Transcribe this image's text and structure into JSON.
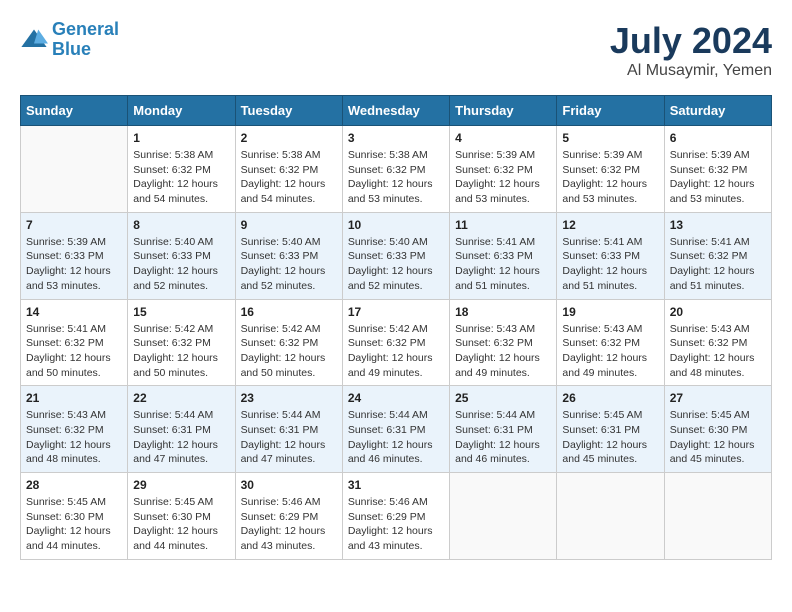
{
  "logo": {
    "line1": "General",
    "line2": "Blue"
  },
  "title": "July 2024",
  "subtitle": "Al Musaymir, Yemen",
  "days_header": [
    "Sunday",
    "Monday",
    "Tuesday",
    "Wednesday",
    "Thursday",
    "Friday",
    "Saturday"
  ],
  "weeks": [
    [
      {
        "day": "",
        "sunrise": "",
        "sunset": "",
        "daylight": ""
      },
      {
        "day": "1",
        "sunrise": "Sunrise: 5:38 AM",
        "sunset": "Sunset: 6:32 PM",
        "daylight": "Daylight: 12 hours and 54 minutes."
      },
      {
        "day": "2",
        "sunrise": "Sunrise: 5:38 AM",
        "sunset": "Sunset: 6:32 PM",
        "daylight": "Daylight: 12 hours and 54 minutes."
      },
      {
        "day": "3",
        "sunrise": "Sunrise: 5:38 AM",
        "sunset": "Sunset: 6:32 PM",
        "daylight": "Daylight: 12 hours and 53 minutes."
      },
      {
        "day": "4",
        "sunrise": "Sunrise: 5:39 AM",
        "sunset": "Sunset: 6:32 PM",
        "daylight": "Daylight: 12 hours and 53 minutes."
      },
      {
        "day": "5",
        "sunrise": "Sunrise: 5:39 AM",
        "sunset": "Sunset: 6:32 PM",
        "daylight": "Daylight: 12 hours and 53 minutes."
      },
      {
        "day": "6",
        "sunrise": "Sunrise: 5:39 AM",
        "sunset": "Sunset: 6:32 PM",
        "daylight": "Daylight: 12 hours and 53 minutes."
      }
    ],
    [
      {
        "day": "7",
        "sunrise": "Sunrise: 5:39 AM",
        "sunset": "Sunset: 6:33 PM",
        "daylight": "Daylight: 12 hours and 53 minutes."
      },
      {
        "day": "8",
        "sunrise": "Sunrise: 5:40 AM",
        "sunset": "Sunset: 6:33 PM",
        "daylight": "Daylight: 12 hours and 52 minutes."
      },
      {
        "day": "9",
        "sunrise": "Sunrise: 5:40 AM",
        "sunset": "Sunset: 6:33 PM",
        "daylight": "Daylight: 12 hours and 52 minutes."
      },
      {
        "day": "10",
        "sunrise": "Sunrise: 5:40 AM",
        "sunset": "Sunset: 6:33 PM",
        "daylight": "Daylight: 12 hours and 52 minutes."
      },
      {
        "day": "11",
        "sunrise": "Sunrise: 5:41 AM",
        "sunset": "Sunset: 6:33 PM",
        "daylight": "Daylight: 12 hours and 51 minutes."
      },
      {
        "day": "12",
        "sunrise": "Sunrise: 5:41 AM",
        "sunset": "Sunset: 6:33 PM",
        "daylight": "Daylight: 12 hours and 51 minutes."
      },
      {
        "day": "13",
        "sunrise": "Sunrise: 5:41 AM",
        "sunset": "Sunset: 6:32 PM",
        "daylight": "Daylight: 12 hours and 51 minutes."
      }
    ],
    [
      {
        "day": "14",
        "sunrise": "Sunrise: 5:41 AM",
        "sunset": "Sunset: 6:32 PM",
        "daylight": "Daylight: 12 hours and 50 minutes."
      },
      {
        "day": "15",
        "sunrise": "Sunrise: 5:42 AM",
        "sunset": "Sunset: 6:32 PM",
        "daylight": "Daylight: 12 hours and 50 minutes."
      },
      {
        "day": "16",
        "sunrise": "Sunrise: 5:42 AM",
        "sunset": "Sunset: 6:32 PM",
        "daylight": "Daylight: 12 hours and 50 minutes."
      },
      {
        "day": "17",
        "sunrise": "Sunrise: 5:42 AM",
        "sunset": "Sunset: 6:32 PM",
        "daylight": "Daylight: 12 hours and 49 minutes."
      },
      {
        "day": "18",
        "sunrise": "Sunrise: 5:43 AM",
        "sunset": "Sunset: 6:32 PM",
        "daylight": "Daylight: 12 hours and 49 minutes."
      },
      {
        "day": "19",
        "sunrise": "Sunrise: 5:43 AM",
        "sunset": "Sunset: 6:32 PM",
        "daylight": "Daylight: 12 hours and 49 minutes."
      },
      {
        "day": "20",
        "sunrise": "Sunrise: 5:43 AM",
        "sunset": "Sunset: 6:32 PM",
        "daylight": "Daylight: 12 hours and 48 minutes."
      }
    ],
    [
      {
        "day": "21",
        "sunrise": "Sunrise: 5:43 AM",
        "sunset": "Sunset: 6:32 PM",
        "daylight": "Daylight: 12 hours and 48 minutes."
      },
      {
        "day": "22",
        "sunrise": "Sunrise: 5:44 AM",
        "sunset": "Sunset: 6:31 PM",
        "daylight": "Daylight: 12 hours and 47 minutes."
      },
      {
        "day": "23",
        "sunrise": "Sunrise: 5:44 AM",
        "sunset": "Sunset: 6:31 PM",
        "daylight": "Daylight: 12 hours and 47 minutes."
      },
      {
        "day": "24",
        "sunrise": "Sunrise: 5:44 AM",
        "sunset": "Sunset: 6:31 PM",
        "daylight": "Daylight: 12 hours and 46 minutes."
      },
      {
        "day": "25",
        "sunrise": "Sunrise: 5:44 AM",
        "sunset": "Sunset: 6:31 PM",
        "daylight": "Daylight: 12 hours and 46 minutes."
      },
      {
        "day": "26",
        "sunrise": "Sunrise: 5:45 AM",
        "sunset": "Sunset: 6:31 PM",
        "daylight": "Daylight: 12 hours and 45 minutes."
      },
      {
        "day": "27",
        "sunrise": "Sunrise: 5:45 AM",
        "sunset": "Sunset: 6:30 PM",
        "daylight": "Daylight: 12 hours and 45 minutes."
      }
    ],
    [
      {
        "day": "28",
        "sunrise": "Sunrise: 5:45 AM",
        "sunset": "Sunset: 6:30 PM",
        "daylight": "Daylight: 12 hours and 44 minutes."
      },
      {
        "day": "29",
        "sunrise": "Sunrise: 5:45 AM",
        "sunset": "Sunset: 6:30 PM",
        "daylight": "Daylight: 12 hours and 44 minutes."
      },
      {
        "day": "30",
        "sunrise": "Sunrise: 5:46 AM",
        "sunset": "Sunset: 6:29 PM",
        "daylight": "Daylight: 12 hours and 43 minutes."
      },
      {
        "day": "31",
        "sunrise": "Sunrise: 5:46 AM",
        "sunset": "Sunset: 6:29 PM",
        "daylight": "Daylight: 12 hours and 43 minutes."
      },
      {
        "day": "",
        "sunrise": "",
        "sunset": "",
        "daylight": ""
      },
      {
        "day": "",
        "sunrise": "",
        "sunset": "",
        "daylight": ""
      },
      {
        "day": "",
        "sunrise": "",
        "sunset": "",
        "daylight": ""
      }
    ]
  ]
}
